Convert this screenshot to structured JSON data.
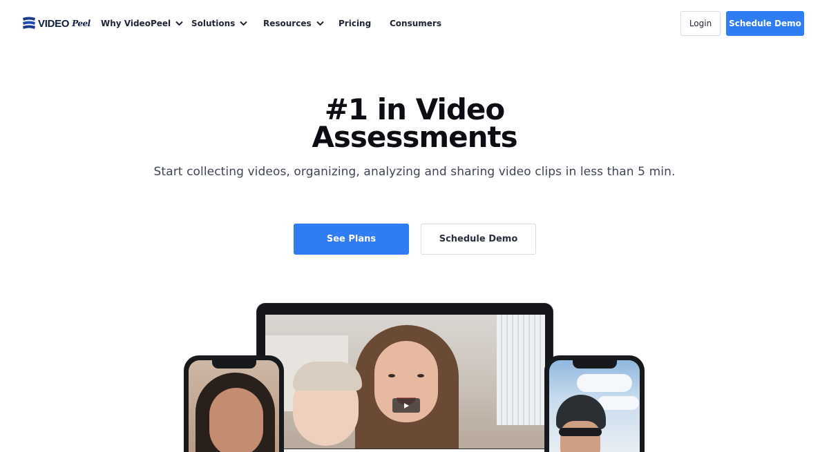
{
  "brand": {
    "logo_text": "VIDEO",
    "logo_script": "Peel",
    "colors": {
      "accent": "#2f7cf3",
      "text_dark": "#0b0d12",
      "logo": "#0d1b3e"
    }
  },
  "nav": {
    "items": [
      {
        "label": "Why VideoPeel",
        "has_dropdown": true
      },
      {
        "label": "Solutions",
        "has_dropdown": true
      },
      {
        "label": "Resources",
        "has_dropdown": true
      },
      {
        "label": "Pricing",
        "has_dropdown": false
      },
      {
        "label": "Consumers",
        "has_dropdown": false
      }
    ],
    "login_label": "Login",
    "schedule_demo_label": "Schedule Demo"
  },
  "hero": {
    "title_line1": "#1 in Video",
    "title_line2": "Assessments",
    "subtitle": "Start collecting videos, organizing, analyzing and sharing video clips in less than 5 min.",
    "primary_cta": "See Plans",
    "secondary_cta": "Schedule Demo"
  },
  "media": {
    "play_icon": "play-icon"
  }
}
